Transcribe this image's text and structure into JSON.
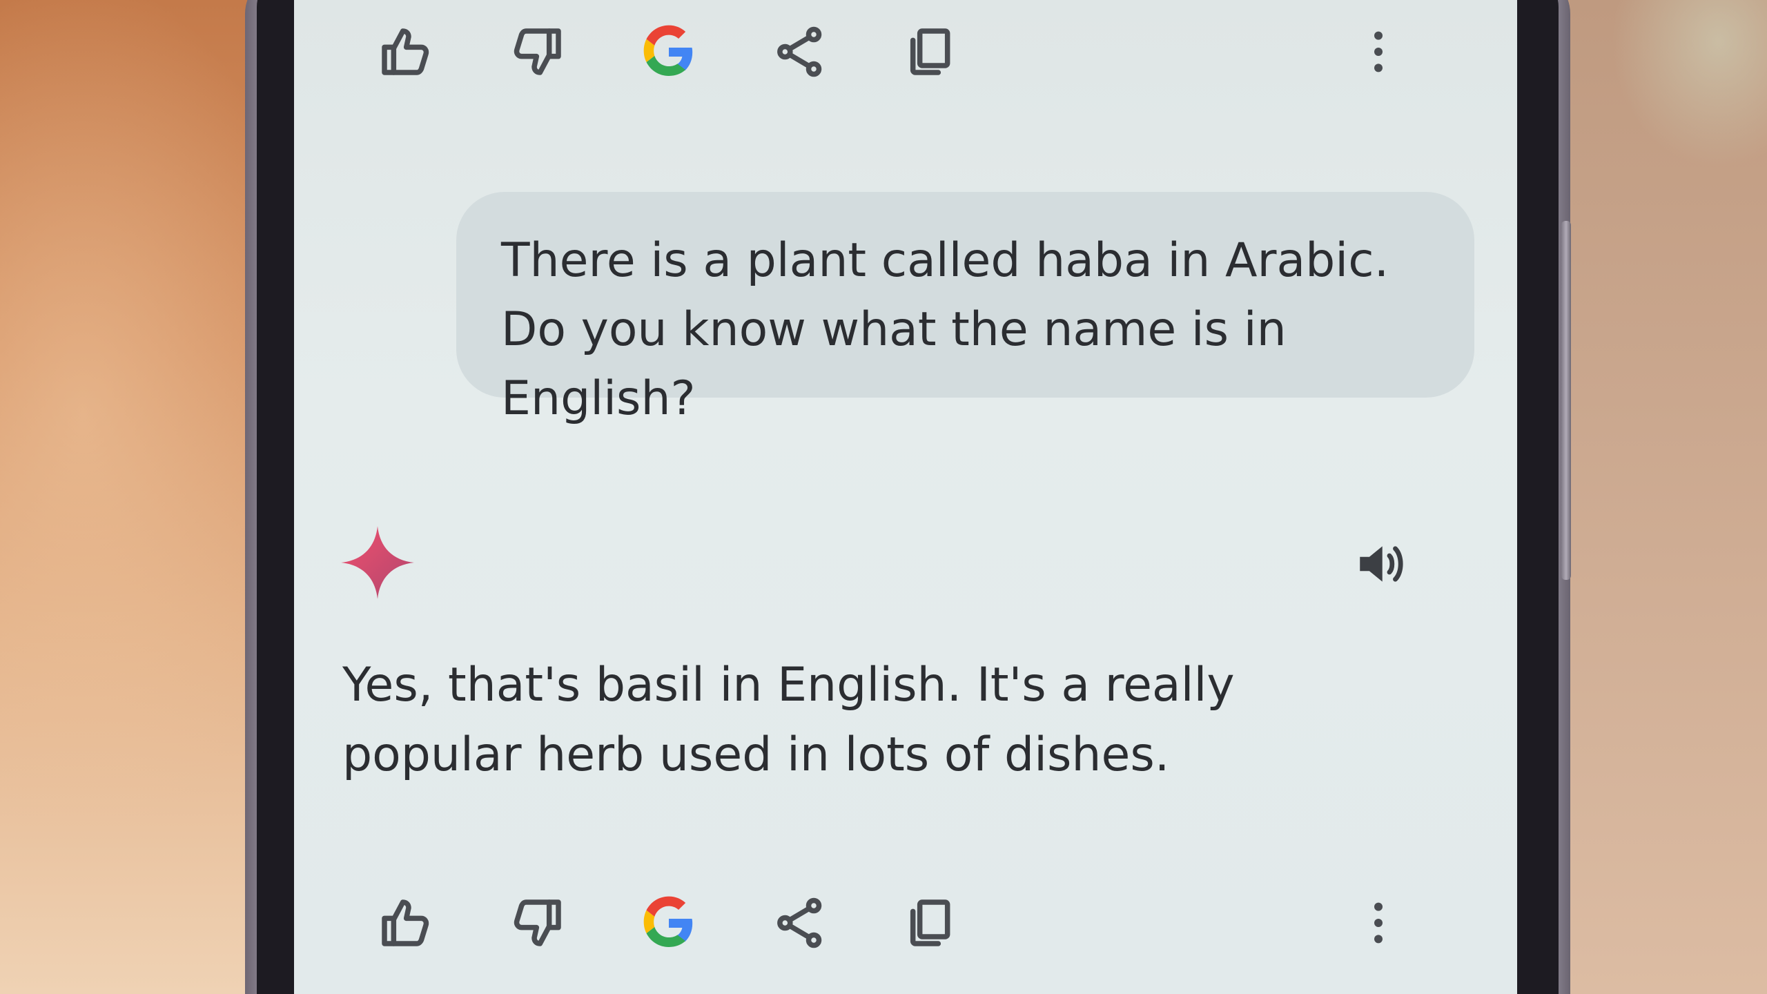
{
  "conversation": {
    "user_message": "There is a plant called haba in Arabic. Do you know what the name is in English?",
    "assistant_message": "Yes, that's basil in English. It's a really popular herb used in lots of dishes."
  },
  "toolbar_icons": [
    "thumbs-up-icon",
    "thumbs-down-icon",
    "google-icon",
    "share-icon",
    "copy-icon",
    "more-vert-icon"
  ],
  "assistant_icons": [
    "sparkle-icon",
    "speaker-icon"
  ],
  "colors": {
    "screen_background": "#e2eaeb",
    "user_bubble": "#d3dcde",
    "text": "#2b2d31",
    "icon": "#4a4d52",
    "sparkle_start": "#e0456b",
    "sparkle_end": "#b84a6e",
    "google_blue": "#4285f4",
    "google_red": "#ea4335",
    "google_yellow": "#fbbc05",
    "google_green": "#34a853"
  }
}
